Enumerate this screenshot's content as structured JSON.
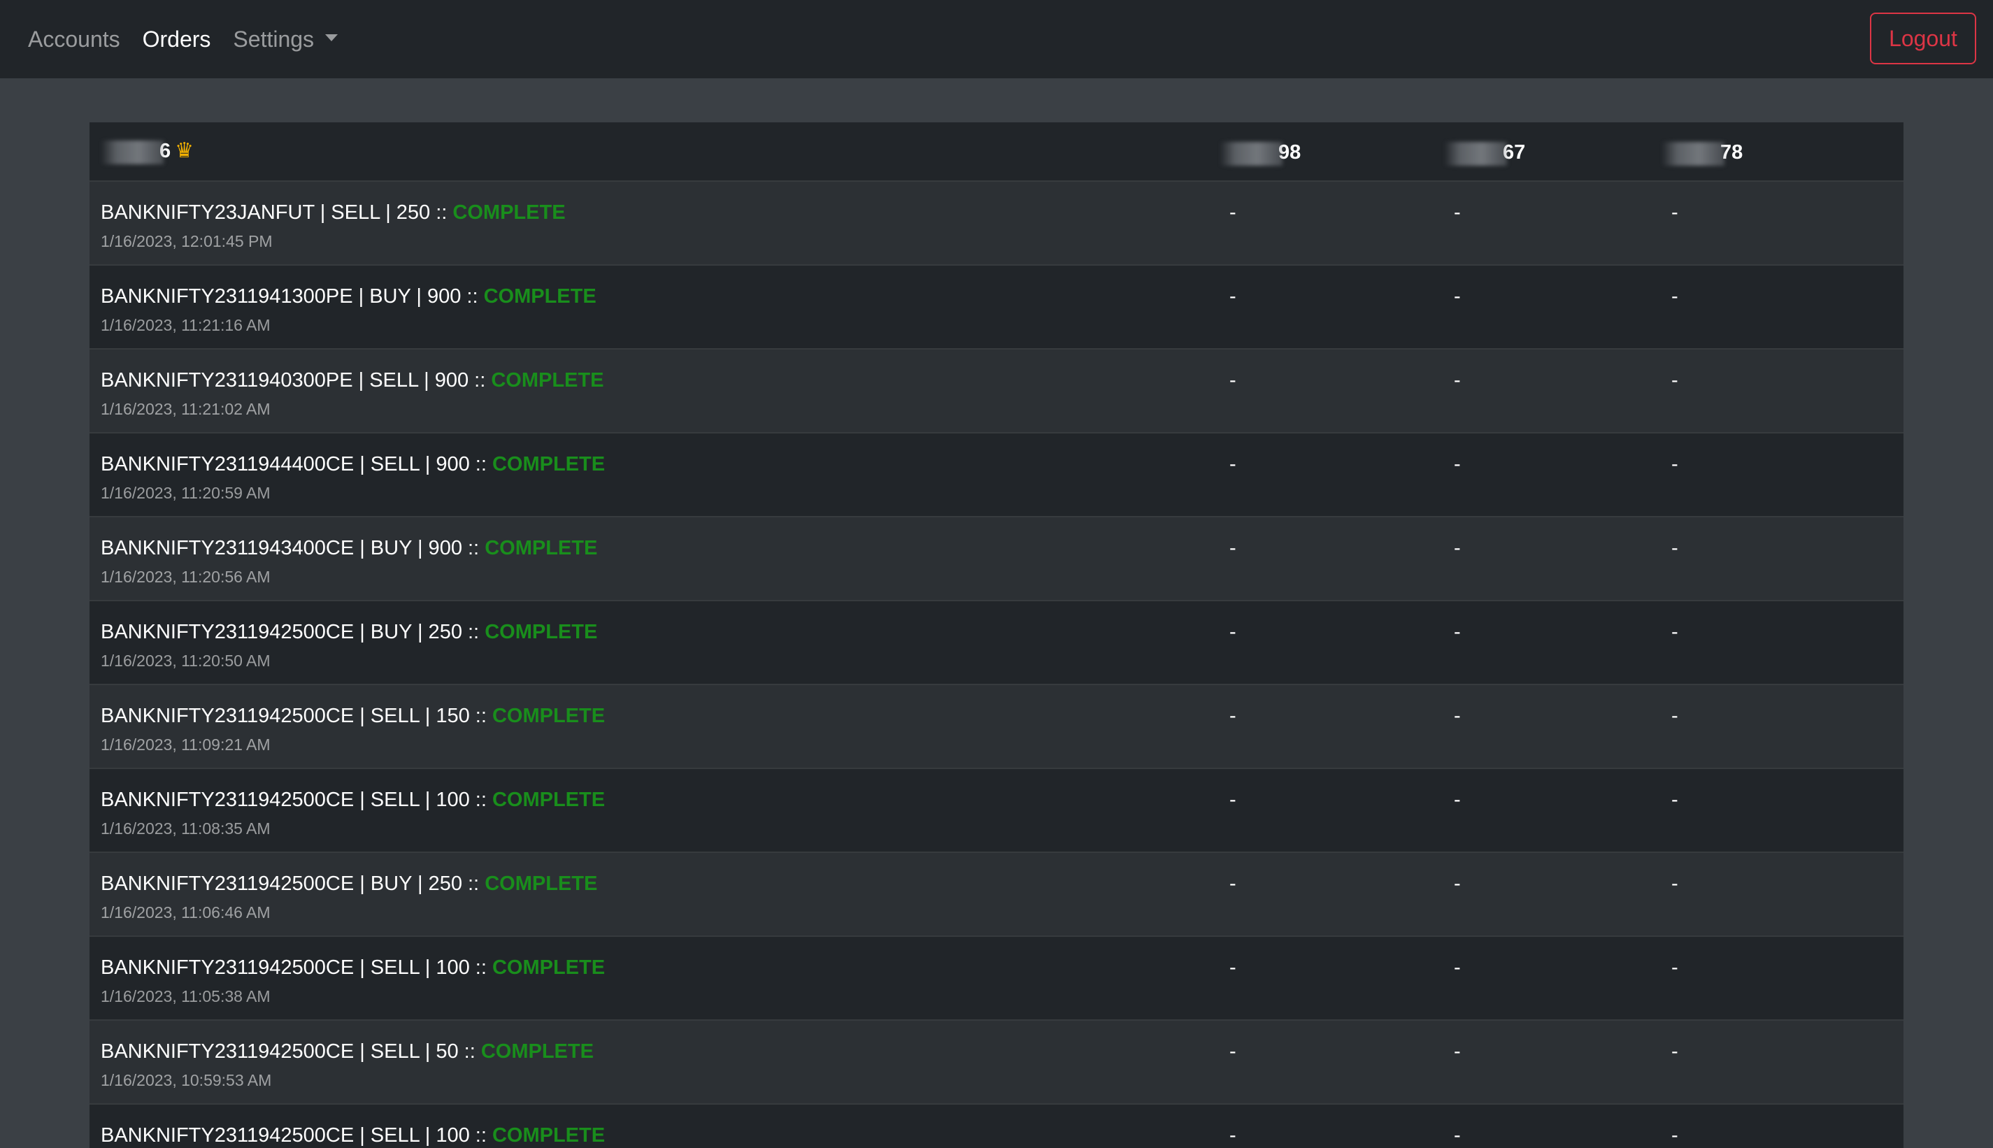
{
  "nav": {
    "links": [
      {
        "label": "Accounts",
        "active": false
      },
      {
        "label": "Orders",
        "active": true
      },
      {
        "label": "Settings",
        "active": false
      }
    ],
    "logout_label": "Logout"
  },
  "table": {
    "header": {
      "main_suffix": "6",
      "acc1_suffix": "98",
      "acc2_suffix": "67",
      "acc3_suffix": "78"
    },
    "rows": [
      {
        "title": "BANKNIFTY23JANFUT | SELL | 250 :: ",
        "status": "COMPLETE",
        "time": "1/16/2023, 12:01:45 PM",
        "acc1": "-",
        "acc2": "-",
        "acc3": "-"
      },
      {
        "title": "BANKNIFTY2311941300PE | BUY | 900 :: ",
        "status": "COMPLETE",
        "time": "1/16/2023, 11:21:16 AM",
        "acc1": "-",
        "acc2": "-",
        "acc3": "-"
      },
      {
        "title": "BANKNIFTY2311940300PE | SELL | 900 :: ",
        "status": "COMPLETE",
        "time": "1/16/2023, 11:21:02 AM",
        "acc1": "-",
        "acc2": "-",
        "acc3": "-"
      },
      {
        "title": "BANKNIFTY2311944400CE | SELL | 900 :: ",
        "status": "COMPLETE",
        "time": "1/16/2023, 11:20:59 AM",
        "acc1": "-",
        "acc2": "-",
        "acc3": "-"
      },
      {
        "title": "BANKNIFTY2311943400CE | BUY | 900 :: ",
        "status": "COMPLETE",
        "time": "1/16/2023, 11:20:56 AM",
        "acc1": "-",
        "acc2": "-",
        "acc3": "-"
      },
      {
        "title": "BANKNIFTY2311942500CE | BUY | 250 :: ",
        "status": "COMPLETE",
        "time": "1/16/2023, 11:20:50 AM",
        "acc1": "-",
        "acc2": "-",
        "acc3": "-"
      },
      {
        "title": "BANKNIFTY2311942500CE | SELL | 150 :: ",
        "status": "COMPLETE",
        "time": "1/16/2023, 11:09:21 AM",
        "acc1": "-",
        "acc2": "-",
        "acc3": "-"
      },
      {
        "title": "BANKNIFTY2311942500CE | SELL | 100 :: ",
        "status": "COMPLETE",
        "time": "1/16/2023, 11:08:35 AM",
        "acc1": "-",
        "acc2": "-",
        "acc3": "-"
      },
      {
        "title": "BANKNIFTY2311942500CE | BUY | 250 :: ",
        "status": "COMPLETE",
        "time": "1/16/2023, 11:06:46 AM",
        "acc1": "-",
        "acc2": "-",
        "acc3": "-"
      },
      {
        "title": "BANKNIFTY2311942500CE | SELL | 100 :: ",
        "status": "COMPLETE",
        "time": "1/16/2023, 11:05:38 AM",
        "acc1": "-",
        "acc2": "-",
        "acc3": "-"
      },
      {
        "title": "BANKNIFTY2311942500CE | SELL | 50 :: ",
        "status": "COMPLETE",
        "time": "1/16/2023, 10:59:53 AM",
        "acc1": "-",
        "acc2": "-",
        "acc3": "-"
      },
      {
        "title": "BANKNIFTY2311942500CE | SELL | 100 :: ",
        "status": "COMPLETE",
        "time": "",
        "acc1": "-",
        "acc2": "-",
        "acc3": "-"
      }
    ]
  },
  "colors": {
    "navbar_bg": "#212529",
    "page_bg": "#3b4045",
    "row_odd": "#2c3034",
    "row_even": "#212529",
    "status_complete": "#198e1c",
    "logout": "#dc3545"
  },
  "icons": {
    "owner_marker": "crown-icon",
    "settings_dropdown": "caret-down-icon"
  }
}
